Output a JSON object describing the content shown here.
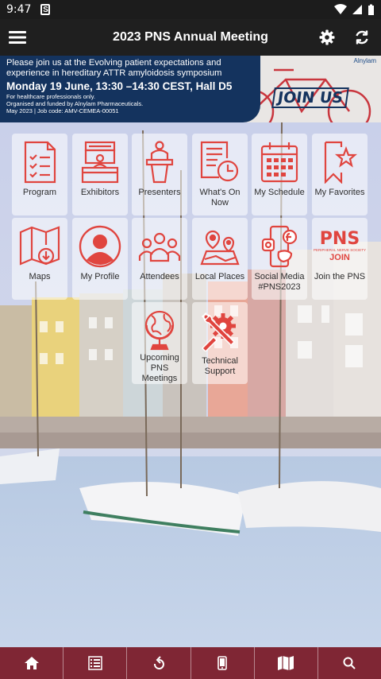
{
  "status_bar": {
    "time": "9:47",
    "s_icon": "S"
  },
  "app_bar": {
    "title": "2023 PNS Annual Meeting"
  },
  "banner": {
    "line1": "Please join us at the Evolving patient expectations and",
    "line1b": "experience in hereditary ATTR amyloidosis symposium",
    "line2": "Monday 19 June, 13:30 –14:30 CEST, Hall D5",
    "small1": "For healthcare professionals only.",
    "small2": "Organised and funded by Alnylam Pharmaceuticals.",
    "small3": "May 2023  |  Job code: AMV-CEMEA-00051",
    "brand": "Alnylam",
    "join_us": "JOIN US"
  },
  "tiles": [
    {
      "label": "Program",
      "icon": "program-icon"
    },
    {
      "label": "Exhibitors",
      "icon": "exhibitors-icon"
    },
    {
      "label": "Presenters",
      "icon": "presenters-icon"
    },
    {
      "label": "What's On Now",
      "icon": "whats-on-now-icon"
    },
    {
      "label": "My Schedule",
      "icon": "calendar-icon"
    },
    {
      "label": "My Favorites",
      "icon": "bookmark-star-icon"
    },
    {
      "label": "Maps",
      "icon": "map-icon"
    },
    {
      "label": "My Profile",
      "icon": "profile-icon"
    },
    {
      "label": "Attendees",
      "icon": "attendees-icon"
    },
    {
      "label": "Local Places",
      "icon": "local-places-icon"
    },
    {
      "label": "Social Media #PNS2023",
      "icon": "social-media-icon"
    },
    {
      "label": "Join the PNS",
      "icon": "pns-join-logo"
    },
    {
      "label": "Upcoming PNS Meetings",
      "icon": "globe-icon"
    },
    {
      "label": "Technical Support",
      "icon": "tools-icon"
    }
  ],
  "pns_logo": {
    "text": "PNS",
    "subtext": "PERIPHERAL NERVE SOCIETY",
    "join": "JOIN"
  },
  "bottom_nav": [
    "home-icon",
    "list-icon",
    "back-icon",
    "phone-icon",
    "map-icon",
    "search-icon"
  ],
  "colors": {
    "accent": "#e0453f",
    "nav": "#7f2634",
    "appbar": "#1f1f1f",
    "banner": "#14335e"
  }
}
